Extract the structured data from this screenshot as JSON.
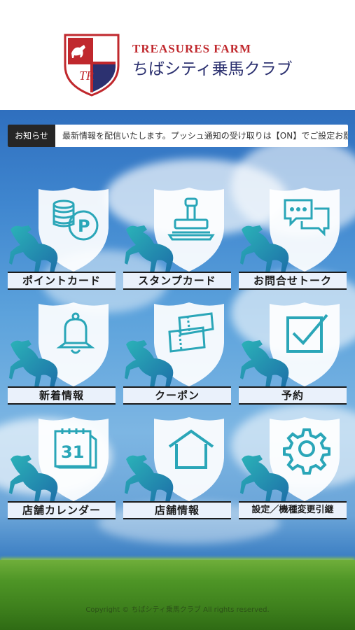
{
  "header": {
    "brand_top": "TREASURES FARM",
    "brand_main": "ちばシティ乗馬クラブ",
    "crest_letters": "TR"
  },
  "ticker": {
    "label": "お知らせ",
    "text": "最新情報を配信いたします。プッシュ通知の受け取りは【ON】でご設定お願いします。"
  },
  "menu": {
    "items": [
      {
        "label": "ポイントカード",
        "icon": "coins-p-icon"
      },
      {
        "label": "スタンプカード",
        "icon": "stamp-icon"
      },
      {
        "label": "お問合せトーク",
        "icon": "chat-icon"
      },
      {
        "label": "新着情報",
        "icon": "bell-icon"
      },
      {
        "label": "クーポン",
        "icon": "coupon-icon"
      },
      {
        "label": "予約",
        "icon": "checkbox-icon"
      },
      {
        "label": "店舗カレンダー",
        "icon": "calendar-icon",
        "calendar_day": "31"
      },
      {
        "label": "店舗情報",
        "icon": "house-icon"
      },
      {
        "label": "設定／機種変更引継",
        "icon": "gear-icon"
      }
    ]
  },
  "footer": {
    "copyright": "Copyright © ちばシティ乗馬クラブ All rights reserved."
  },
  "colors": {
    "accent_teal": "#2aa6b8",
    "brand_red": "#c0282d",
    "brand_navy": "#2c3170"
  }
}
